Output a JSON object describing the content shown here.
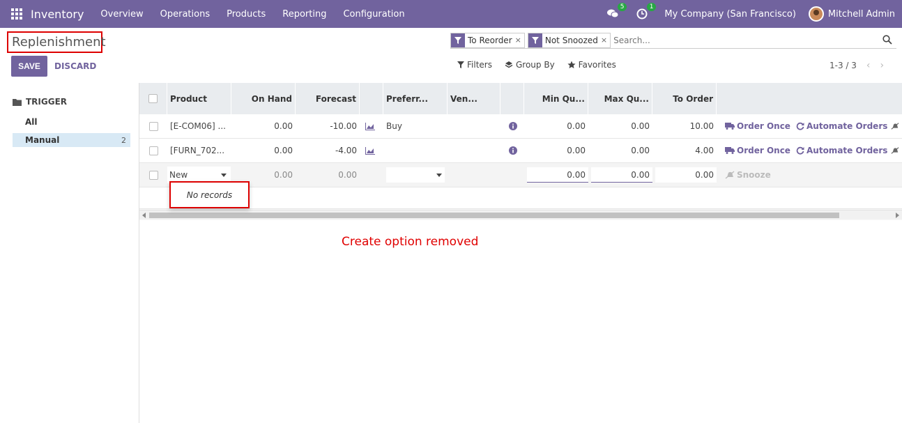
{
  "navbar": {
    "brand": "Inventory",
    "menu": [
      "Overview",
      "Operations",
      "Products",
      "Reporting",
      "Configuration"
    ],
    "messages_count": "5",
    "activities_count": "1",
    "company": "My Company (San Francisco)",
    "user": "Mitchell Admin"
  },
  "page": {
    "title": "Replenishment",
    "save_label": "SAVE",
    "discard_label": "DISCARD"
  },
  "search": {
    "facets": [
      "To Reorder",
      "Not Snoozed"
    ],
    "facet_close": "×",
    "placeholder": "Search..."
  },
  "filters": {
    "filters_label": "Filters",
    "group_by_label": "Group By",
    "favorites_label": "Favorites"
  },
  "pager": {
    "value": "1-3 / 3",
    "prev": "‹",
    "next": "›"
  },
  "sidebar": {
    "header": "TRIGGER",
    "items": [
      {
        "label": "All",
        "count": ""
      },
      {
        "label": "Manual",
        "count": "2"
      }
    ]
  },
  "table": {
    "columns": [
      "Product",
      "On Hand",
      "Forecast",
      "Preferr...",
      "Ven...",
      "Min Qu...",
      "Max Qu...",
      "To Order"
    ],
    "rows": [
      {
        "product": "[E-COM06] ...",
        "on_hand": "0.00",
        "forecast": "-10.00",
        "route": "Buy",
        "min": "0.00",
        "max": "0.00",
        "to_order": "10.00",
        "order_once": "Order Once",
        "automate": "Automate Orders"
      },
      {
        "product": "[FURN_702...",
        "on_hand": "0.00",
        "forecast": "-4.00",
        "route": "",
        "min": "0.00",
        "max": "0.00",
        "to_order": "4.00",
        "order_once": "Order Once",
        "automate": "Automate Orders"
      }
    ],
    "edit_row": {
      "product": "New",
      "on_hand": "0.00",
      "forecast": "0.00",
      "min": "0.00",
      "max": "0.00",
      "to_order": "0.00",
      "snooze": "Snooze"
    },
    "dropdown_text": "No records"
  },
  "annotation": "Create option removed",
  "colors": {
    "brand": "#71639e",
    "annotation": "#e00000",
    "badge": "#28a745"
  }
}
